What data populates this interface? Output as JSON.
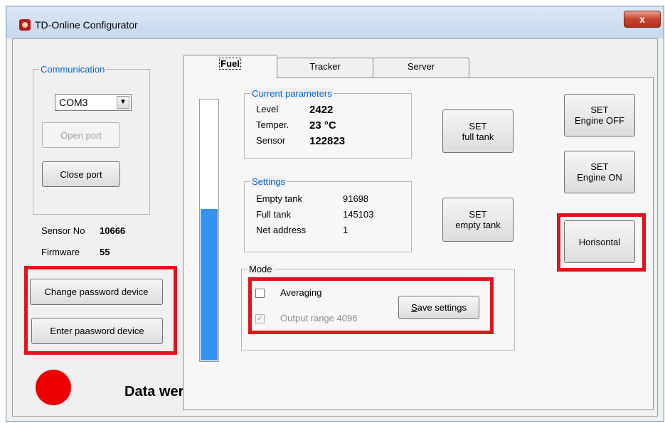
{
  "window": {
    "title": "TD-Online Configurator",
    "close_label": "x"
  },
  "communication": {
    "label": "Communication",
    "port_value": "COM3",
    "open_label": "Open port",
    "close_label": "Close port"
  },
  "sensor": {
    "label": "Sensor No",
    "value": "10666"
  },
  "firmware": {
    "label": "Firmware",
    "value": "55"
  },
  "password": {
    "change_label": "Change password device",
    "enter_label": "Enter paasword device"
  },
  "tabs": [
    {
      "label": "Fuel"
    },
    {
      "label": "Tracker"
    },
    {
      "label": "Server"
    }
  ],
  "fuel": {
    "level_fraction": 0.58,
    "current": {
      "label": "Current parameters",
      "level_label": "Level",
      "level_value": "2422",
      "temper_label": "Temper.",
      "temper_value": "23 °C",
      "sensor_label": "Sensor",
      "sensor_value": "122823"
    },
    "settings": {
      "label": "Settings",
      "empty_label": "Empty tank",
      "empty_value": "91698",
      "full_label": "Full tank",
      "full_value": "145103",
      "net_label": "Net address",
      "net_value": "1"
    },
    "set_full_label": "SET\nfull tank",
    "set_empty_label": "SET\nempty tank",
    "engine_off_label": "SET\nEngine OFF",
    "engine_on_label": "SET\nEngine ON",
    "horisontal_label": "Horisontal",
    "mode": {
      "label": "Mode",
      "averaging_label": "Averaging",
      "averaging_checked": false,
      "output_label": "Output range 4096",
      "output_checked": true,
      "save_label": "Save settings"
    }
  },
  "status": {
    "message": "Data were obtained.",
    "indicator_color": "#ee0000"
  }
}
